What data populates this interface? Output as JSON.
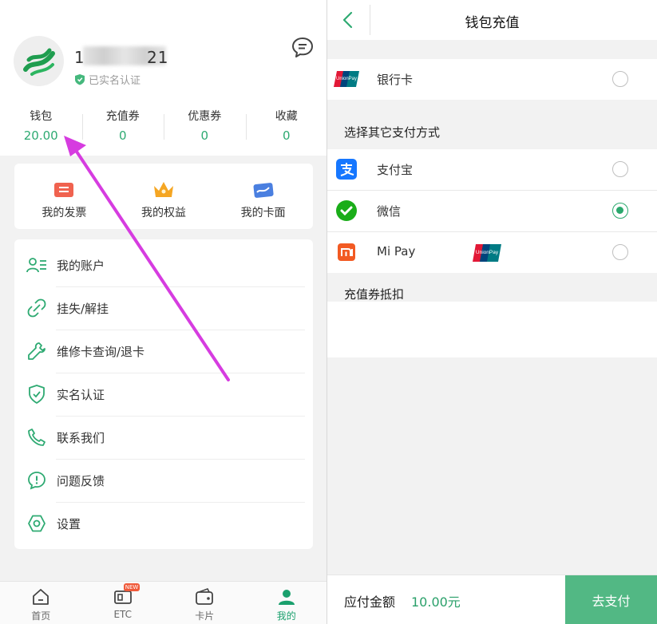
{
  "profile": {
    "phone_start": "1",
    "phone_end": "21",
    "verified_label": "已实名认证"
  },
  "stats": [
    {
      "label": "钱包",
      "value": "20.00"
    },
    {
      "label": "充值券",
      "value": "0"
    },
    {
      "label": "优惠券",
      "value": "0"
    },
    {
      "label": "收藏",
      "value": "0"
    }
  ],
  "quick_actions": [
    {
      "label": "我的发票",
      "icon": "invoice-icon"
    },
    {
      "label": "我的权益",
      "icon": "crown-icon"
    },
    {
      "label": "我的卡面",
      "icon": "card-face-icon"
    }
  ],
  "menu": [
    {
      "label": "我的账户",
      "icon": "account-icon"
    },
    {
      "label": "挂失/解挂",
      "icon": "unlink-icon"
    },
    {
      "label": "维修卡查询/退卡",
      "icon": "wrench-icon"
    },
    {
      "label": "实名认证",
      "icon": "shield-check-icon"
    },
    {
      "label": "联系我们",
      "icon": "phone-icon"
    },
    {
      "label": "问题反馈",
      "icon": "feedback-icon"
    },
    {
      "label": "设置",
      "icon": "settings-icon"
    }
  ],
  "tabbar": [
    {
      "label": "首页",
      "icon": "home-icon",
      "active": false
    },
    {
      "label": "ETC",
      "icon": "etc-icon",
      "active": false,
      "badge": "NEW"
    },
    {
      "label": "卡片",
      "icon": "wallet-icon",
      "active": false
    },
    {
      "label": "我的",
      "icon": "user-icon",
      "active": true
    }
  ],
  "recharge": {
    "title": "钱包充值",
    "bank_card_label": "银行卡",
    "other_methods_title": "选择其它支付方式",
    "methods": [
      {
        "label": "支付宝",
        "icon": "alipay-icon",
        "selected": false
      },
      {
        "label": "微信",
        "icon": "wechat-icon",
        "selected": true
      },
      {
        "label": "Mi Pay",
        "icon": "mi-icon",
        "selected": false
      }
    ],
    "coupon_title": "充值券抵扣",
    "amount_label": "应付金额",
    "amount_value": "10.00元",
    "pay_button": "去支付"
  },
  "colors": {
    "accent": "#2eaa72",
    "pay_button": "#52b884",
    "annotation_arrow": "#d63ce0"
  }
}
